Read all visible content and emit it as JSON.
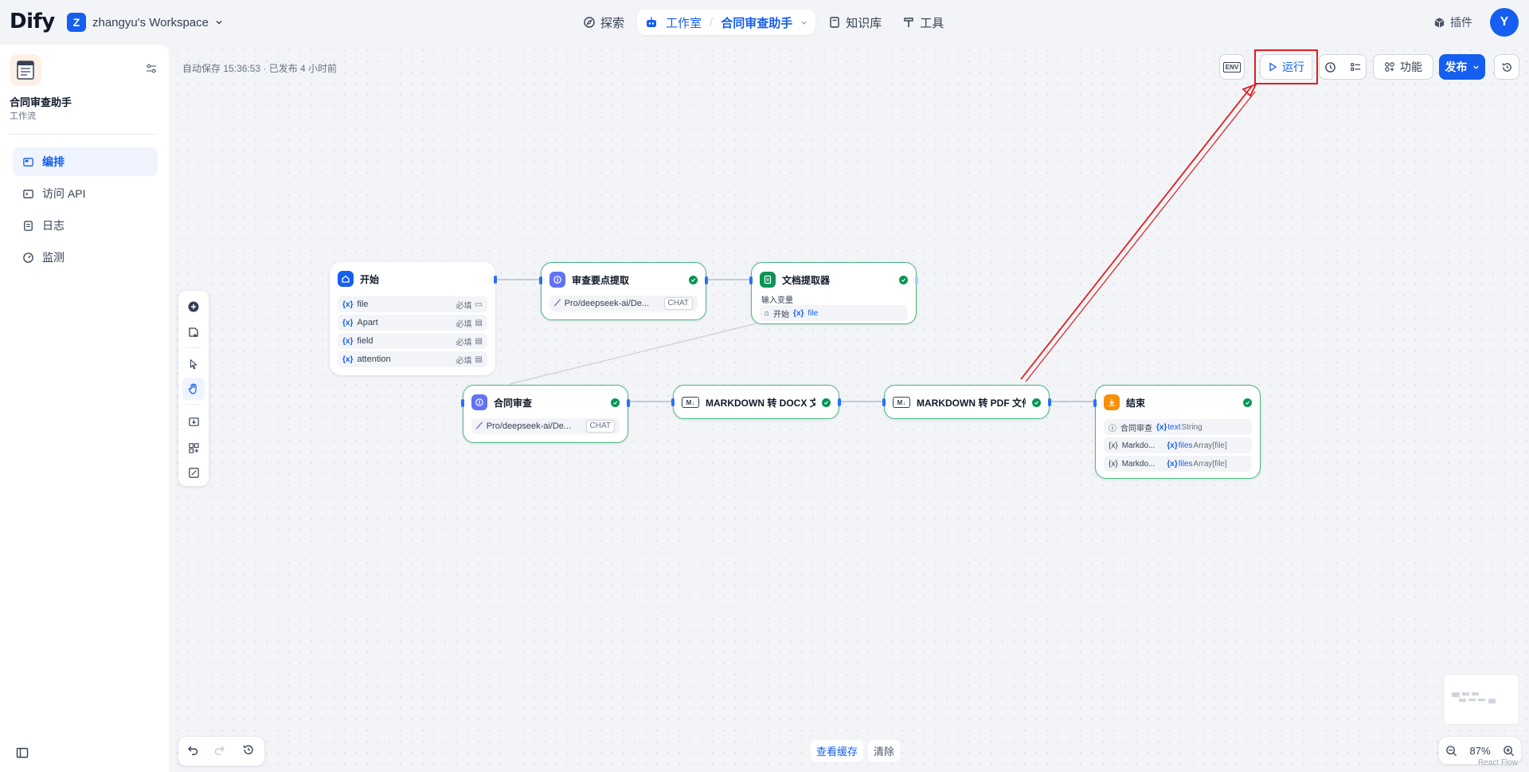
{
  "header": {
    "logo": "Dify",
    "workspace_initial": "Z",
    "workspace_name": "zhangyu's Workspace",
    "nav": {
      "explore": "探索",
      "studio": "工作室",
      "current_app": "合同审查助手",
      "knowledge": "知识库",
      "tools": "工具"
    },
    "plugins": "插件",
    "avatar_initial": "Y"
  },
  "sidebar": {
    "app_name": "合同审查助手",
    "app_type": "工作流",
    "items": [
      {
        "label": "编排",
        "icon": "orchestrate-icon",
        "active": true
      },
      {
        "label": "访问 API",
        "icon": "terminal-icon",
        "active": false
      },
      {
        "label": "日志",
        "icon": "log-icon",
        "active": false
      },
      {
        "label": "监测",
        "icon": "monitor-icon",
        "active": false
      }
    ]
  },
  "canvas": {
    "autosave": "自动保存 15:36:53 · 已发布 4 小时前",
    "toolbar": {
      "env": "ENV",
      "run": "运行",
      "features": "功能",
      "publish": "发布"
    },
    "cache": {
      "view": "查看缓存",
      "clear": "清除"
    },
    "zoom": "87%",
    "attribution": "React Flow"
  },
  "nodes": {
    "start": {
      "title": "开始",
      "fields": [
        {
          "name": "file",
          "req": "必填"
        },
        {
          "name": "Apart",
          "req": "必填"
        },
        {
          "name": "field",
          "req": "必填"
        },
        {
          "name": "attention",
          "req": "必填"
        }
      ]
    },
    "extract": {
      "title": "审查要点提取",
      "model": "Pro/deepseek-ai/De...",
      "mode": "CHAT"
    },
    "doc_extractor": {
      "title": "文档提取器",
      "input_label": "输入变量",
      "source": "开始",
      "var": "file"
    },
    "review": {
      "title": "合同审查",
      "model": "Pro/deepseek-ai/De...",
      "mode": "CHAT"
    },
    "md_docx": {
      "title": "MARKDOWN 转 DOCX 文件"
    },
    "md_pdf": {
      "title": "MARKDOWN 转 PDF 文件"
    },
    "end": {
      "title": "结束",
      "outputs": [
        {
          "source": "合同审查",
          "var": "text",
          "type": "String"
        },
        {
          "source": "Markdo...",
          "var": "files",
          "type": "Array[file]"
        },
        {
          "source": "Markdo...",
          "var": "files",
          "type": "Array[file]"
        }
      ]
    }
  },
  "colors": {
    "primary": "#155eef",
    "success": "#079455",
    "annotation": "#e11d1d"
  }
}
